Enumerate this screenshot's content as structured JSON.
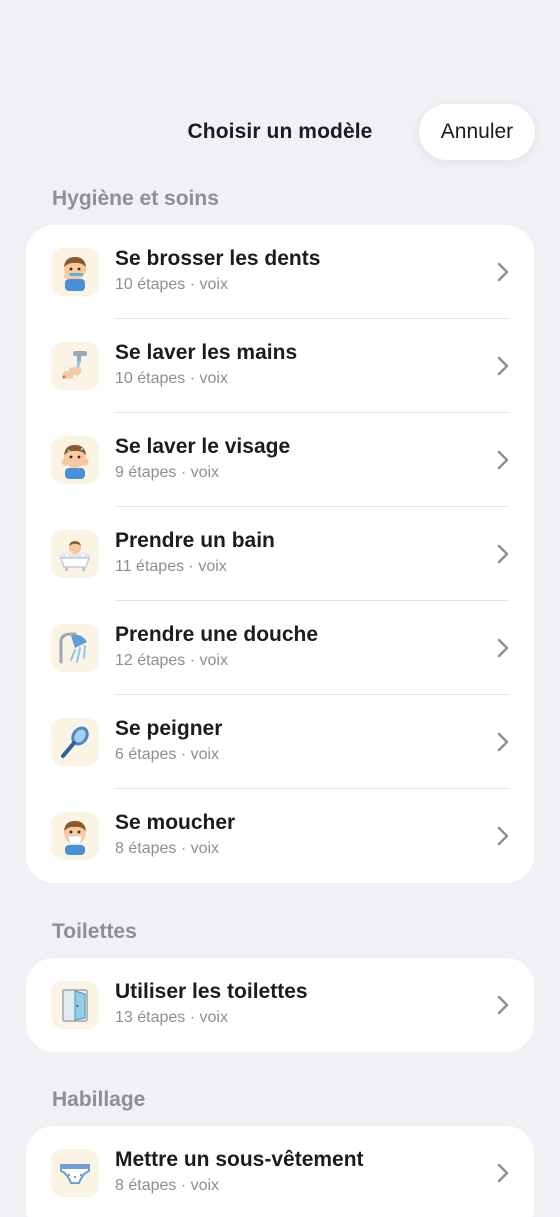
{
  "header": {
    "title": "Choisir un modèle",
    "cancel_label": "Annuler"
  },
  "sections": [
    {
      "title": "Hygiène et soins",
      "items": [
        {
          "title": "Se brosser les dents",
          "subtitle": "10 étapes · voix",
          "icon": "toothbrush-child-icon"
        },
        {
          "title": "Se laver les mains",
          "subtitle": "10 étapes · voix",
          "icon": "handwash-icon"
        },
        {
          "title": "Se laver le visage",
          "subtitle": "9 étapes · voix",
          "icon": "face-wash-icon"
        },
        {
          "title": "Prendre un bain",
          "subtitle": "11 étapes · voix",
          "icon": "bathtub-icon"
        },
        {
          "title": "Prendre une douche",
          "subtitle": "12 étapes · voix",
          "icon": "shower-icon"
        },
        {
          "title": "Se peigner",
          "subtitle": "6 étapes · voix",
          "icon": "hairbrush-icon"
        },
        {
          "title": "Se moucher",
          "subtitle": "8 étapes · voix",
          "icon": "tissue-nose-icon"
        }
      ]
    },
    {
      "title": "Toilettes",
      "items": [
        {
          "title": "Utiliser les toilettes",
          "subtitle": "13 étapes · voix",
          "icon": "toilet-door-icon"
        }
      ]
    },
    {
      "title": "Habillage",
      "items": [
        {
          "title": "Mettre un sous-vêtement",
          "subtitle": "8 étapes · voix",
          "icon": "underwear-icon"
        }
      ]
    }
  ]
}
